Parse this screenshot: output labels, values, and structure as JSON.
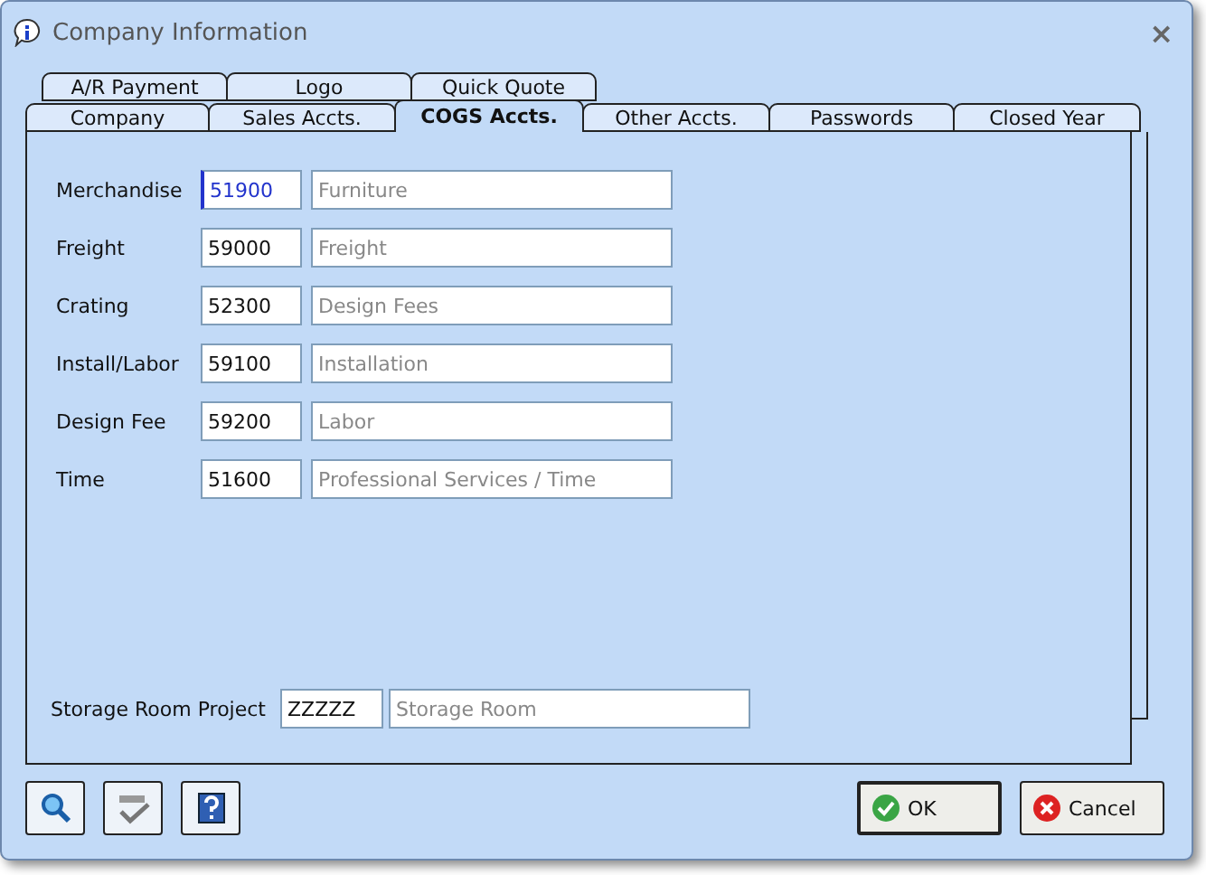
{
  "window": {
    "title": "Company Information",
    "close": "×"
  },
  "tab_rows": [
    [
      {
        "label": "A/R Payment",
        "selected": false
      },
      {
        "label": "Logo",
        "selected": false
      },
      {
        "label": "Quick Quote",
        "selected": false
      }
    ],
    [
      {
        "label": "Company",
        "selected": false
      },
      {
        "label": "Sales Accts.",
        "selected": false
      },
      {
        "label": "COGS Accts.",
        "selected": true
      },
      {
        "label": "Other Accts.",
        "selected": false
      },
      {
        "label": "Passwords",
        "selected": false
      },
      {
        "label": "Closed Year",
        "selected": false
      }
    ]
  ],
  "accounts": [
    {
      "label": "Merchandise",
      "code": "51900",
      "description": "Furniture",
      "focused": true
    },
    {
      "label": "Freight",
      "code": "59000",
      "description": "Freight",
      "focused": false
    },
    {
      "label": "Crating",
      "code": "52300",
      "description": "Design Fees",
      "focused": false
    },
    {
      "label": "Install/Labor",
      "code": "59100",
      "description": "Installation",
      "focused": false
    },
    {
      "label": "Design Fee",
      "code": "59200",
      "description": "Labor",
      "focused": false
    },
    {
      "label": "Time",
      "code": "51600",
      "description": "Professional Services / Time",
      "focused": false
    }
  ],
  "storage": {
    "label": "Storage Room Project",
    "code": "ZZZZZ",
    "description": "Storage Room"
  },
  "tools": [
    {
      "kind": "search"
    },
    {
      "kind": "spell"
    },
    {
      "kind": "help"
    }
  ],
  "buttons": [
    {
      "kind": "ok",
      "label": "OK",
      "default": true
    },
    {
      "kind": "cancel",
      "label": "Cancel",
      "default": false
    }
  ]
}
